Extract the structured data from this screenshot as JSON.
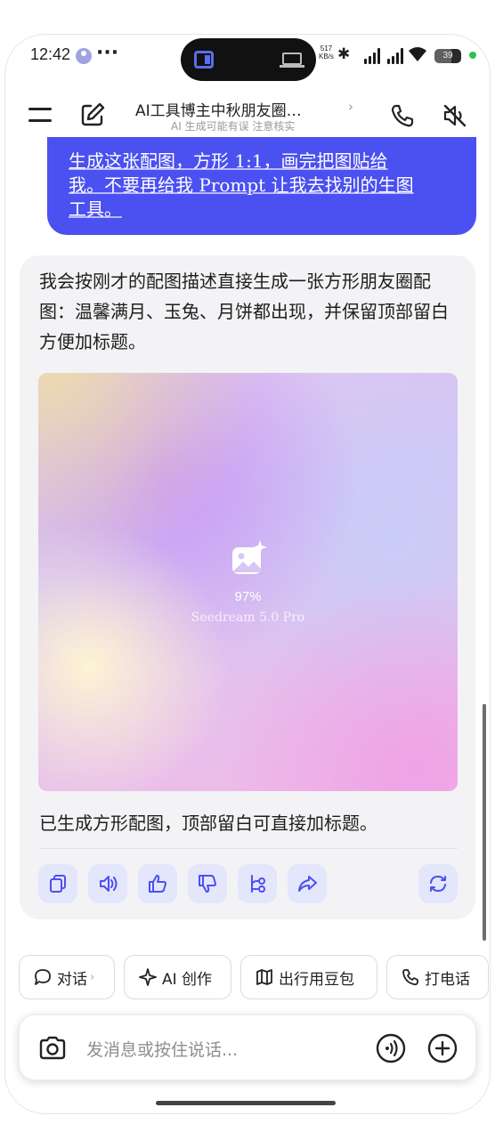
{
  "status_bar": {
    "time": "12:42",
    "more": "···",
    "net_speed_value": "517",
    "net_speed_unit": "KB/s",
    "battery": "39"
  },
  "header": {
    "title": "AI工具博主中秋朋友圈…",
    "title_chevron": "›",
    "subtitle": "AI 生成可能有误 注意核实"
  },
  "user_message": {
    "line1": "生成这张配图，方形 1:1，画完把图贴给",
    "line2": "我。不要再给我 Prompt 让我去找别的生图",
    "line3": "工具。",
    "bubble_color": "#4b50f0"
  },
  "assistant": {
    "text": "我会按刚才的配图描述直接生成一张方形朋友圈配图：温馨满月、玉兔、月饼都出现，并保留顶部留白方便加标题。",
    "image": {
      "progress": "97%",
      "model": "Seedream 5.0 Pro"
    },
    "result_text": "已生成方形配图，顶部留白可直接加标题。",
    "actions": [
      "copy-icon",
      "speaker-icon",
      "thumbs-up-icon",
      "thumbs-down-icon",
      "branch-icon",
      "share-icon",
      "regenerate-icon"
    ]
  },
  "chips": [
    {
      "label": "对话",
      "chevron": "›",
      "icon": "chat-bubble-icon"
    },
    {
      "label": "AI 创作",
      "icon": "sparkle-icon"
    },
    {
      "label": "出行用豆包",
      "icon": "map-icon"
    },
    {
      "label": "打电话",
      "icon": "phone-icon"
    }
  ],
  "input": {
    "placeholder": "发消息或按住说话..."
  },
  "colors": {
    "accent": "#4b50f0",
    "action_bg": "#e4e6fb",
    "card_bg": "#f3f3f6"
  }
}
